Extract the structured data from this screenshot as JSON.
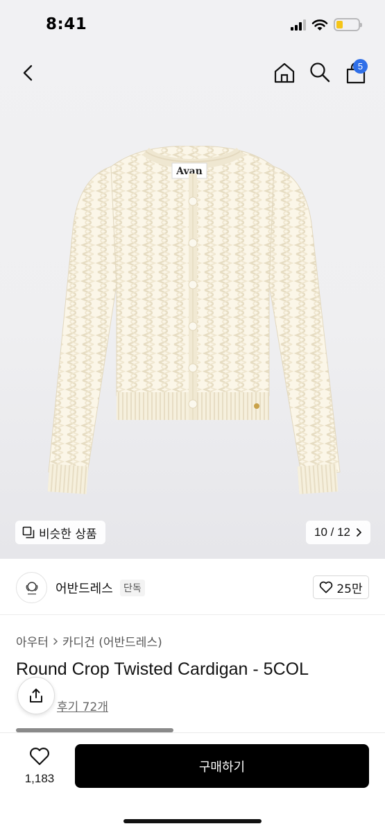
{
  "status_bar": {
    "time": "8:41",
    "battery_level": 0.3,
    "battery_color": "#f5c518"
  },
  "nav": {
    "back_icon": "chevron-left-icon",
    "home_icon": "home-icon",
    "search_icon": "search-icon",
    "cart_icon": "shopping-bag-icon",
    "cart_count": "5",
    "badge_color": "#2f6fe8"
  },
  "gallery": {
    "similar_label": "비슷한 상품",
    "counter": "10 / 12",
    "label_brand": "Avan"
  },
  "brand": {
    "name": "어반드레스",
    "tag": "단독",
    "likes": "25만"
  },
  "product": {
    "breadcrumb": [
      "아우터",
      "카디건 (어반드레스)"
    ],
    "title": "Round Crop Twisted Cardigan - 5COL",
    "review_link": "후기 72개"
  },
  "bottom_bar": {
    "wish_count": "1,183",
    "buy_label": "구매하기"
  }
}
